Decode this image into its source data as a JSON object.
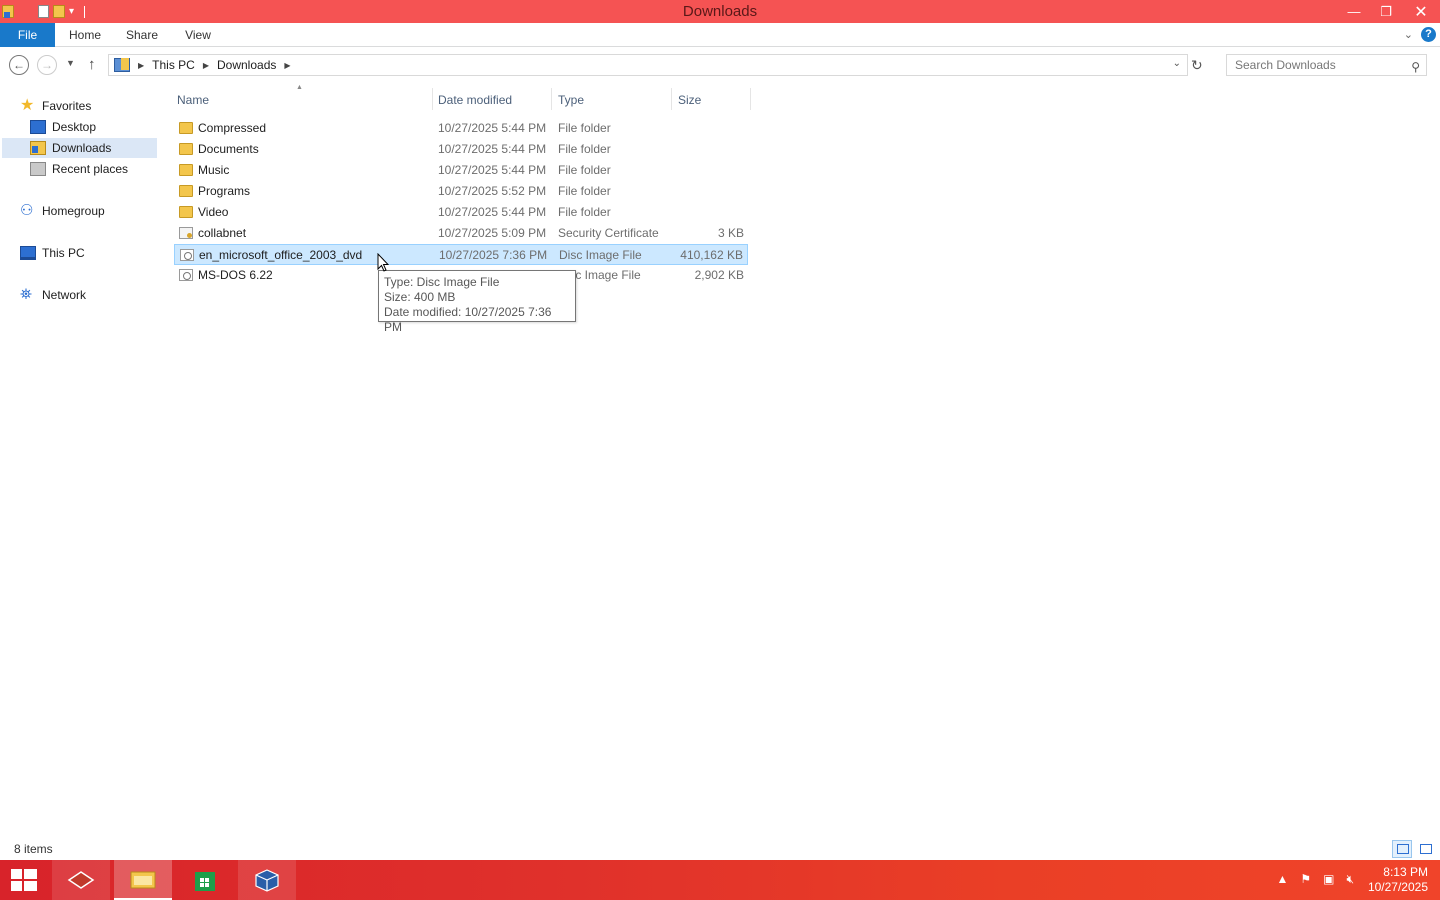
{
  "window": {
    "title": "Downloads",
    "minimize": "—",
    "restore": "❐",
    "close": "✕"
  },
  "ribbon": {
    "tabs": [
      "File",
      "Home",
      "Share",
      "View"
    ],
    "help": "?"
  },
  "address": {
    "crumbs": [
      "This PC",
      "Downloads"
    ],
    "search_placeholder": "Search Downloads"
  },
  "nav": {
    "favorites": "Favorites",
    "desktop": "Desktop",
    "downloads": "Downloads",
    "recent": "Recent places",
    "homegroup": "Homegroup",
    "thispc": "This PC",
    "network": "Network"
  },
  "columns": {
    "name": "Name",
    "date": "Date modified",
    "type": "Type",
    "size": "Size"
  },
  "files": [
    {
      "name": "Compressed",
      "date": "10/27/2025 5:44 PM",
      "type": "File folder",
      "size": "",
      "icon": "folder-icon"
    },
    {
      "name": "Documents",
      "date": "10/27/2025 5:44 PM",
      "type": "File folder",
      "size": "",
      "icon": "folder-icon"
    },
    {
      "name": "Music",
      "date": "10/27/2025 5:44 PM",
      "type": "File folder",
      "size": "",
      "icon": "folder-icon"
    },
    {
      "name": "Programs",
      "date": "10/27/2025 5:52 PM",
      "type": "File folder",
      "size": "",
      "icon": "folder-icon"
    },
    {
      "name": "Video",
      "date": "10/27/2025 5:44 PM",
      "type": "File folder",
      "size": "",
      "icon": "folder-icon"
    },
    {
      "name": "collabnet",
      "date": "10/27/2025 5:09 PM",
      "type": "Security Certificate",
      "size": "3 KB",
      "icon": "certificate-icon"
    },
    {
      "name": "en_microsoft_office_2003_dvd",
      "date": "10/27/2025 7:36 PM",
      "type": "Disc Image File",
      "size": "410,162 KB",
      "icon": "disc-image-icon",
      "selected": true
    },
    {
      "name": "MS-DOS 6.22",
      "date": "",
      "type": "Disc Image File",
      "size": "2,902 KB",
      "icon": "disc-image-icon"
    }
  ],
  "tooltip": {
    "line1": "Type: Disc Image File",
    "line2": "Size: 400 MB",
    "line3": "Date modified: 10/27/2025 7:36 PM"
  },
  "status": {
    "count": "8 items"
  },
  "taskbar": {
    "time": "8:13 PM",
    "date": "10/27/2025"
  },
  "colors": {
    "titlebar": "#f55353",
    "file_tab": "#1979ca",
    "selection": "#cce8ff",
    "taskbar": "#e0312b"
  }
}
